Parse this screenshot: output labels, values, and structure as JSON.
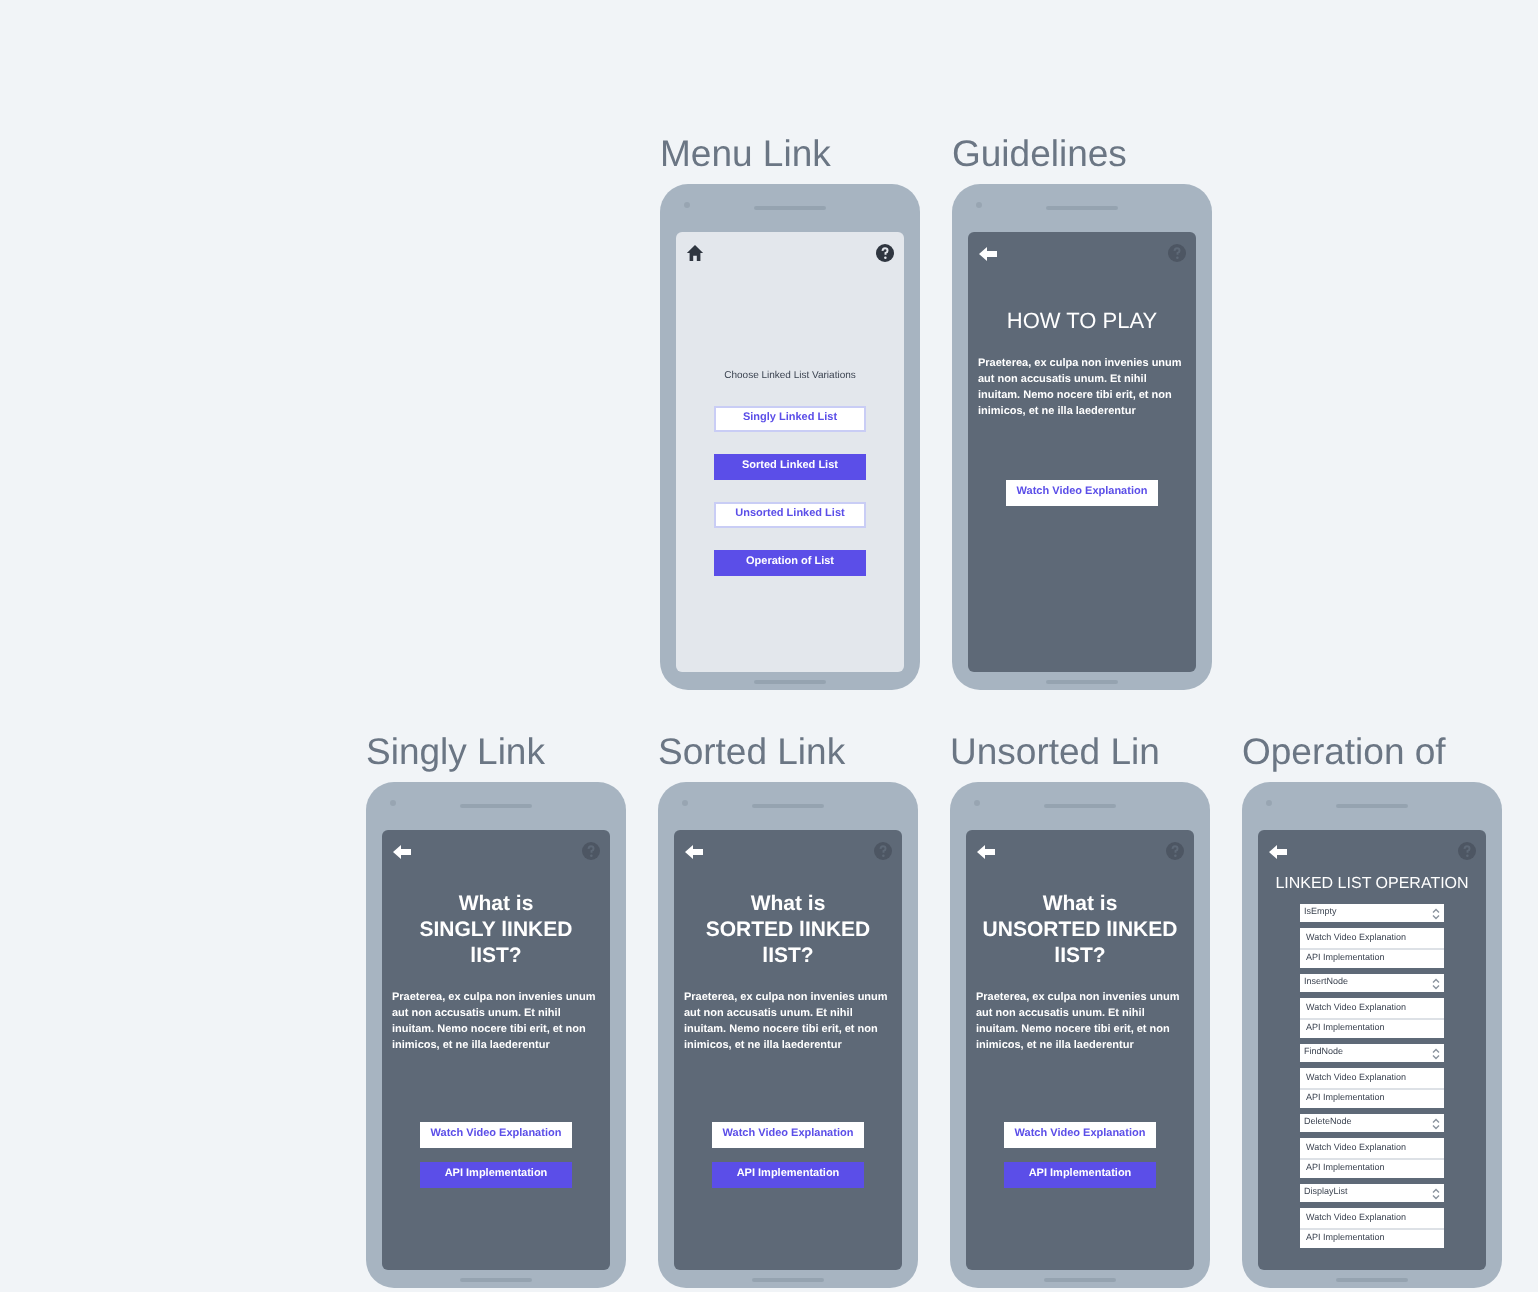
{
  "rows": [
    [
      {
        "title": "Menu Link",
        "kind": "menu",
        "heading": "Choose Linked List Variations",
        "buttons": [
          {
            "label": "Singly Linked List",
            "kind": "outline"
          },
          {
            "label": "Sorted Linked List",
            "kind": "filled"
          },
          {
            "label": "Unsorted Linked List",
            "kind": "outline"
          },
          {
            "label": "Operation of List",
            "kind": "filled"
          }
        ]
      },
      {
        "title": "Guidelines",
        "kind": "guide",
        "heading": [
          "HOW TO PLAY"
        ],
        "paragraph": "Praeterea, ex culpa non invenies unum aut non accusatis unum. Et nihil inuitam. Nemo nocere tibi erit, et non inimicos, et ne illa laederentur",
        "buttons": [
          {
            "label": "Watch Video Explanation",
            "kind": "outline"
          }
        ]
      }
    ],
    [
      {
        "title": "Singly Link",
        "kind": "info",
        "heading": [
          "What is",
          "SINGLY lINKED lIST?"
        ],
        "paragraph": "Praeterea, ex culpa non invenies unum aut non accusatis unum. Et nihil inuitam. Nemo nocere tibi erit, et non inimicos, et ne illa laederentur",
        "buttons": [
          {
            "label": "Watch Video Explanation",
            "kind": "outline"
          },
          {
            "label": "API Implementation",
            "kind": "filled"
          }
        ]
      },
      {
        "title": "Sorted Link",
        "kind": "info",
        "heading": [
          "What is",
          "SORTED lINKED lIST?"
        ],
        "paragraph": "Praeterea, ex culpa non invenies unum aut non accusatis unum. Et nihil inuitam. Nemo nocere tibi erit, et non inimicos, et ne illa laederentur",
        "buttons": [
          {
            "label": "Watch Video Explanation",
            "kind": "outline"
          },
          {
            "label": "API Implementation",
            "kind": "filled"
          }
        ]
      },
      {
        "title": "Unsorted Lin",
        "kind": "info",
        "heading": [
          "What is",
          "UNSORTED lINKED lIST?"
        ],
        "paragraph": "Praeterea, ex culpa non invenies unum aut non accusatis unum. Et nihil inuitam. Nemo nocere tibi erit, et non inimicos, et ne illa laederentur",
        "buttons": [
          {
            "label": "Watch Video Explanation",
            "kind": "outline"
          },
          {
            "label": "API Implementation",
            "kind": "filled"
          }
        ]
      },
      {
        "title": "Operation of",
        "kind": "operation",
        "heading": [
          "LINKED LIST OPERATION"
        ],
        "operations": [
          {
            "select": "IsEmpty",
            "options": [
              "Watch Video Explanation",
              "API Implementation"
            ]
          },
          {
            "select": "InsertNode",
            "options": [
              "Watch Video Explanation",
              "API Implementation"
            ]
          },
          {
            "select": "FindNode",
            "options": [
              "Watch Video Explanation",
              "API Implementation"
            ]
          },
          {
            "select": "DeleteNode",
            "options": [
              "Watch Video Explanation",
              "API Implementation"
            ]
          },
          {
            "select": "DisplayList",
            "options": [
              "Watch Video Explanation",
              "API Implementation"
            ]
          }
        ]
      }
    ]
  ]
}
